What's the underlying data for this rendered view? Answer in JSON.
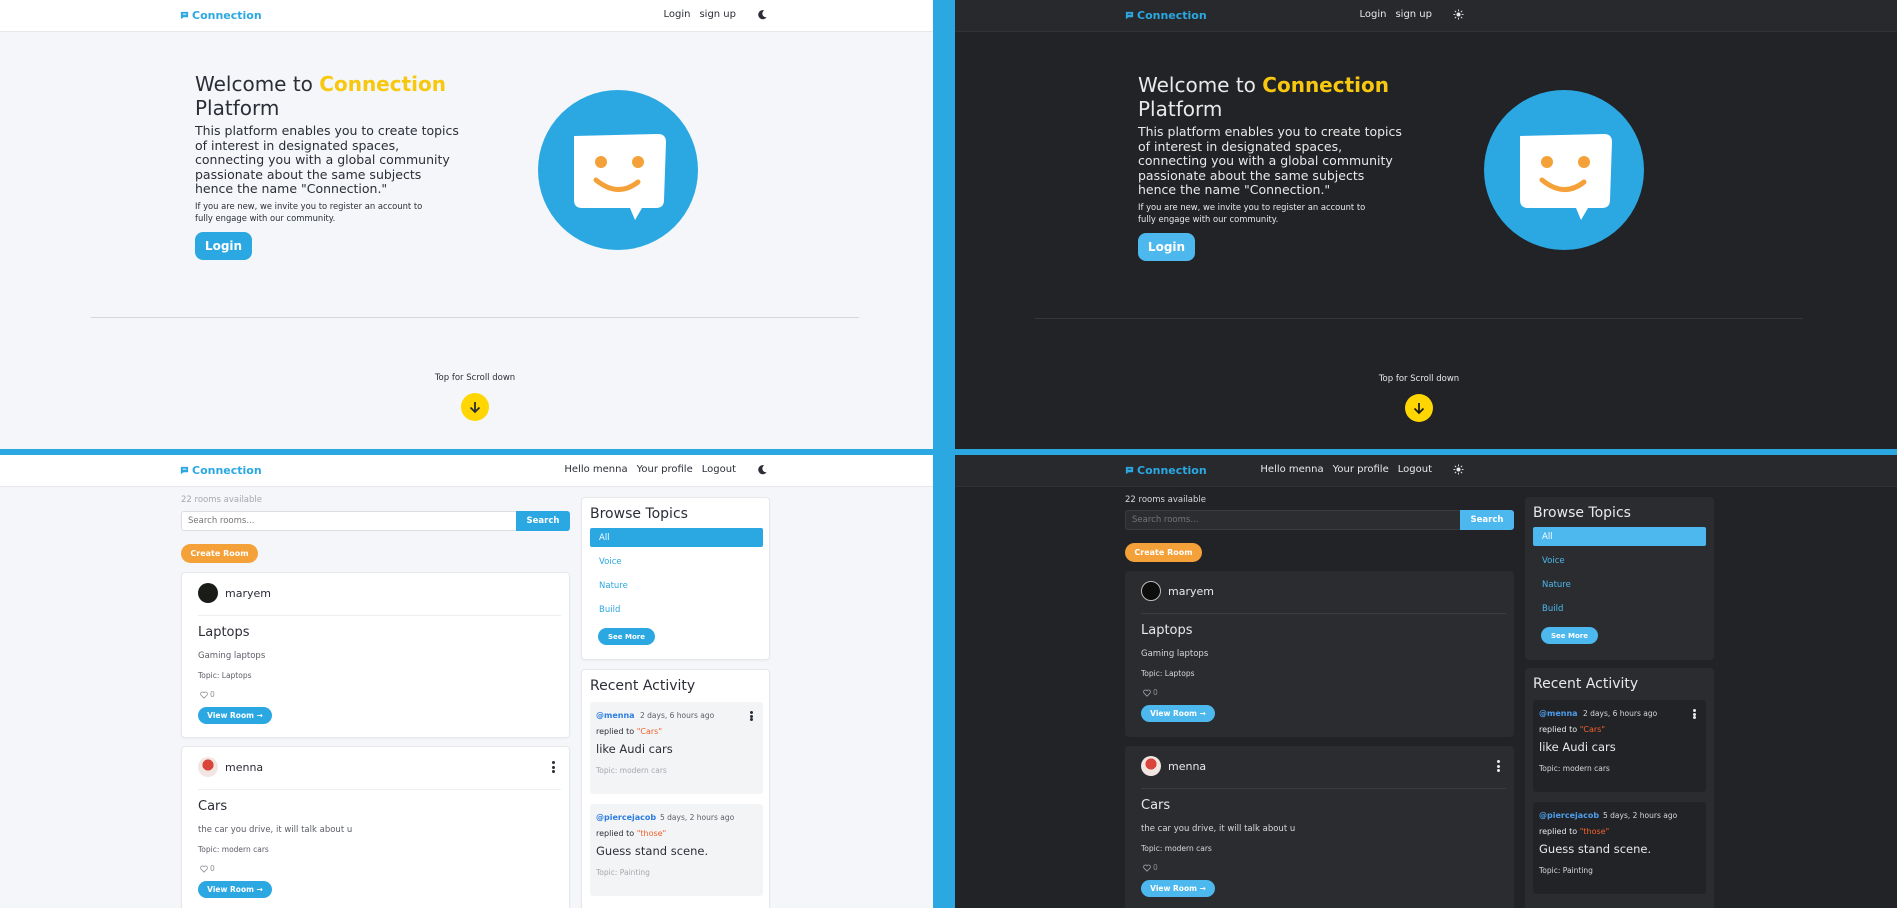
{
  "brand": {
    "name": "Connection"
  },
  "guest_nav": {
    "login": "Login",
    "signup": "sign up"
  },
  "user_nav": {
    "greeting": "Hello menna",
    "profile": "Your profile",
    "logout": "Logout"
  },
  "hero": {
    "welcome": "Welcome to",
    "accent": "Connection",
    "platform": "Platform",
    "body": "This platform enables you to create topics of interest in designated spaces, connecting you with a global community passionate about the same subjects hence the name \"Connection.\"",
    "small": "If you are new, we invite you to register an account to fully engage with our community.",
    "login_button": "Login",
    "scroll_label": "Top for Scroll down"
  },
  "rooms": {
    "count_light": "22 rooms available",
    "count_dark": "22 rooms available",
    "search_placeholder": "Search rooms...",
    "search_button": "Search",
    "create_button": "Create Room",
    "view_button": "View Room →",
    "items": [
      {
        "host": "maryem",
        "title": "Laptops",
        "description": "Gaming laptops",
        "topic": "Topic: Laptops",
        "likes": "0"
      },
      {
        "host": "menna",
        "title": "Cars",
        "description": "the car you drive, it will talk about u",
        "topic": "Topic: modern cars",
        "likes": "0"
      }
    ]
  },
  "topics": {
    "title": "Browse Topics",
    "items": [
      "All",
      "Voice",
      "Nature",
      "Build"
    ],
    "see_more": "See More"
  },
  "activity": {
    "title": "Recent Activity",
    "items": [
      {
        "user": "@menna",
        "time": "2 days, 6 hours ago",
        "replied": "replied to",
        "target": "\"Cars\"",
        "body": "like Audi cars",
        "topic": "Topic: modern cars"
      },
      {
        "user": "@piercejacob",
        "time": "5 days, 2 hours ago",
        "replied": "replied to",
        "target": "\"those\"",
        "body": "Guess stand scene.",
        "topic": "Topic: Painting"
      }
    ]
  },
  "colors": {
    "primary": "#2ba8e2",
    "accent_yellow": "#f7c80f",
    "orange": "#f5a13a",
    "divider": "#2ba8e2"
  },
  "icons": [
    "chat-logo-icon",
    "moon-icon",
    "sun-icon",
    "arrow-down-icon",
    "heart-icon",
    "kebab-icon"
  ]
}
